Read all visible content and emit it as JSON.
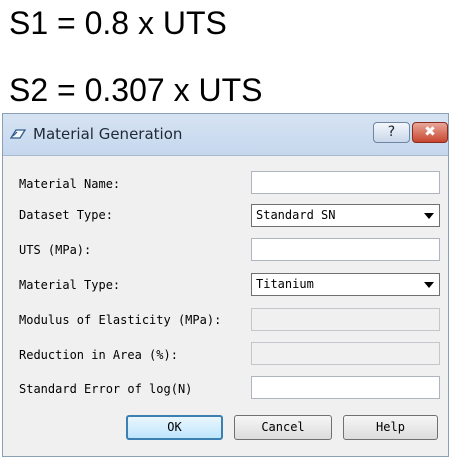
{
  "formulas": {
    "s1": "S1 = 0.8 x UTS",
    "s2": "S2 = 0.307 x UTS"
  },
  "dialog": {
    "title": "Material Generation",
    "help_caption": "?",
    "close_caption": "✖",
    "fields": {
      "material_name": {
        "label": "Material Name:",
        "value": ""
      },
      "dataset_type": {
        "label": "Dataset Type:",
        "value": "Standard SN"
      },
      "uts": {
        "label": "UTS (MPa):",
        "value": ""
      },
      "material_type": {
        "label": "Material Type:",
        "value": "Titanium"
      },
      "modulus": {
        "label": "Modulus of Elasticity (MPa):",
        "value": ""
      },
      "reduction": {
        "label": "Reduction in Area (%):",
        "value": ""
      },
      "std_error": {
        "label": "Standard Error of log(N)",
        "value": ""
      }
    },
    "buttons": {
      "ok": "OK",
      "cancel": "Cancel",
      "help": "Help"
    }
  }
}
